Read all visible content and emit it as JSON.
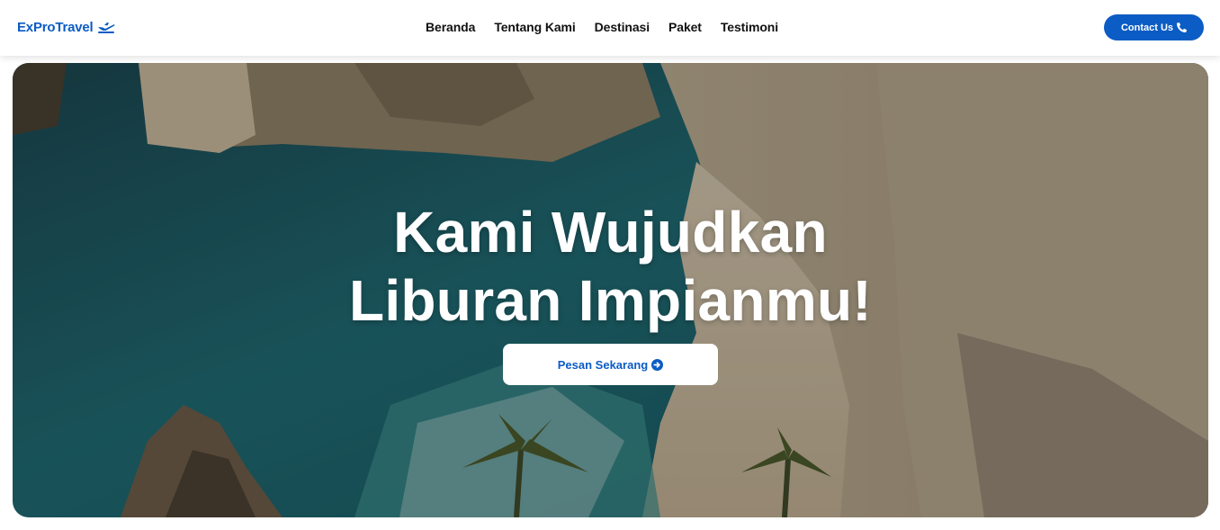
{
  "header": {
    "brand": "ExProTravel",
    "brand_icon": "plane-departure-icon",
    "nav": [
      "Beranda",
      "Tentang Kami",
      "Destinasi",
      "Paket",
      "Testimoni"
    ],
    "contact_label": "Contact Us",
    "contact_icon": "phone-icon"
  },
  "hero": {
    "title_line1": "Kami Wujudkan",
    "title_line2": "Liburan Impianmu!",
    "cta_label": "Pesan Sekarang",
    "cta_icon": "arrow-circle-right-icon",
    "background": "coastal cliffs and beach with palm trees"
  },
  "colors": {
    "brand": "#0b5cc4",
    "cta_bg": "#ffffff",
    "title": "#ffffff"
  }
}
